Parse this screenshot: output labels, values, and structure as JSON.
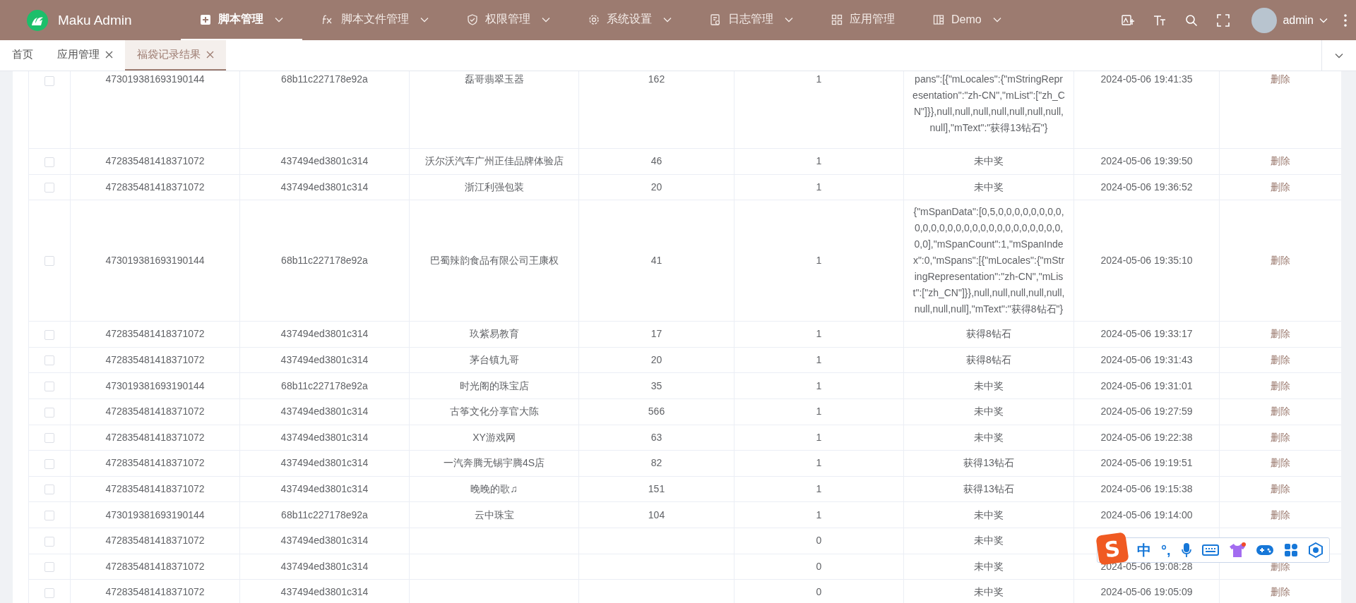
{
  "header": {
    "app_name": "Maku Admin",
    "menu": [
      {
        "label": "脚本管理",
        "kind": "plus",
        "has_submenu": true,
        "selected": true
      },
      {
        "label": "脚本文件管理",
        "kind": "fx",
        "has_submenu": true,
        "selected": false
      },
      {
        "label": "权限管理",
        "kind": "shield",
        "has_submenu": true,
        "selected": false
      },
      {
        "label": "系统设置",
        "kind": "gear",
        "has_submenu": true,
        "selected": false
      },
      {
        "label": "日志管理",
        "kind": "document",
        "has_submenu": true,
        "selected": false
      },
      {
        "label": "应用管理",
        "kind": "grid",
        "has_submenu": false,
        "selected": false
      },
      {
        "label": "Demo",
        "kind": "columns",
        "has_submenu": true,
        "selected": false
      }
    ],
    "user": {
      "name": "admin"
    }
  },
  "tabs": [
    {
      "label": "首页",
      "closable": false,
      "selected": false
    },
    {
      "label": "应用管理",
      "closable": true,
      "selected": false
    },
    {
      "label": "福袋记录结果",
      "closable": true,
      "selected": true
    }
  ],
  "table": {
    "rows": [
      {
        "checked": false,
        "column_2": "473019381693190144",
        "column_3": "68b11c227178e92a",
        "column_4": "磊哥翡翠玉器",
        "column_5": "162",
        "column_6": "1",
        "column_7": "pans\":[{\"mLocales\":{\"mStringRepresentation\":\"zh-CN\",\"mList\":[\"zh_CN\"]}},null,null,null,null,null,null,null,null],\"mText\":\"获得13钻石\"}",
        "column_8": "2024-05-06 19:41:35",
        "column_9": "删除"
      },
      {
        "checked": false,
        "column_2": "472835481418371072",
        "column_3": "437494ed3801c314",
        "column_4": "沃尔沃汽车广州正佳品牌体验店",
        "column_5": "46",
        "column_6": "1",
        "column_7": "未中奖",
        "column_8": "2024-05-06 19:39:50",
        "column_9": "删除"
      },
      {
        "checked": false,
        "column_2": "472835481418371072",
        "column_3": "437494ed3801c314",
        "column_4": "浙江利强包装",
        "column_5": "20",
        "column_6": "1",
        "column_7": "未中奖",
        "column_8": "2024-05-06 19:36:52",
        "column_9": "删除"
      },
      {
        "checked": false,
        "column_2": "473019381693190144",
        "column_3": "68b11c227178e92a",
        "column_4": "巴蜀辣韵食品有限公司王康权",
        "column_5": "41",
        "column_6": "1",
        "column_7": "{\"mSpanData\":[0,5,0,0,0,0,0,0,0,0,0,0,0,0,0,0,0,0,0,0,0,0,0,0,0,0,0,0,0,0],\"mSpanCount\":1,\"mSpanIndex\":0,\"mSpans\":[{\"mLocales\":{\"mStringRepresentation\":\"zh-CN\",\"mList\":[\"zh_CN\"]}},null,null,null,null,null,null,null,null],\"mText\":\"获得8钻石\"}",
        "column_8": "2024-05-06 19:35:10",
        "column_9": "删除"
      },
      {
        "checked": false,
        "column_2": "472835481418371072",
        "column_3": "437494ed3801c314",
        "column_4": "玖紫易教育",
        "column_5": "17",
        "column_6": "1",
        "column_7": "获得8钻石",
        "column_8": "2024-05-06 19:33:17",
        "column_9": "删除"
      },
      {
        "checked": false,
        "column_2": "472835481418371072",
        "column_3": "437494ed3801c314",
        "column_4": "茅台镇九哥",
        "column_5": "20",
        "column_6": "1",
        "column_7": "获得8钻石",
        "column_8": "2024-05-06 19:31:43",
        "column_9": "删除"
      },
      {
        "checked": false,
        "column_2": "473019381693190144",
        "column_3": "68b11c227178e92a",
        "column_4": "时光阁的珠宝店",
        "column_5": "35",
        "column_6": "1",
        "column_7": "未中奖",
        "column_8": "2024-05-06 19:31:01",
        "column_9": "删除"
      },
      {
        "checked": false,
        "column_2": "472835481418371072",
        "column_3": "437494ed3801c314",
        "column_4": "古筝文化分享官大陈",
        "column_5": "566",
        "column_6": "1",
        "column_7": "未中奖",
        "column_8": "2024-05-06 19:27:59",
        "column_9": "删除"
      },
      {
        "checked": false,
        "column_2": "472835481418371072",
        "column_3": "437494ed3801c314",
        "column_4": "XY游戏网",
        "column_5": "63",
        "column_6": "1",
        "column_7": "未中奖",
        "column_8": "2024-05-06 19:22:38",
        "column_9": "删除"
      },
      {
        "checked": false,
        "column_2": "472835481418371072",
        "column_3": "437494ed3801c314",
        "column_4": "一汽奔腾无锡宇腾4S店",
        "column_5": "82",
        "column_6": "1",
        "column_7": "获得13钻石",
        "column_8": "2024-05-06 19:19:51",
        "column_9": "删除"
      },
      {
        "checked": false,
        "column_2": "472835481418371072",
        "column_3": "437494ed3801c314",
        "column_4": "晚晚的歌♫",
        "column_5": "151",
        "column_6": "1",
        "column_7": "获得13钻石",
        "column_8": "2024-05-06 19:15:38",
        "column_9": "删除"
      },
      {
        "checked": false,
        "column_2": "473019381693190144",
        "column_3": "68b11c227178e92a",
        "column_4": "云中珠宝",
        "column_5": "104",
        "column_6": "1",
        "column_7": "未中奖",
        "column_8": "2024-05-06 19:14:00",
        "column_9": "删除"
      },
      {
        "checked": false,
        "column_2": "472835481418371072",
        "column_3": "437494ed3801c314",
        "column_6": "0",
        "column_7": "未中奖"
      },
      {
        "checked": false,
        "column_2": "472835481418371072",
        "column_3": "437494ed3801c314",
        "column_6": "0",
        "column_7": "未中奖",
        "column_8": "2024-05-06 19:08:28",
        "column_9": "删除"
      },
      {
        "checked": false,
        "column_2": "472835481418371072",
        "column_3": "437494ed3801c314",
        "column_6": "0",
        "column_7": "未中奖",
        "column_8": "2024-05-06 19:05:09",
        "column_9": "删除"
      }
    ]
  },
  "input_method_bar": {
    "logo": "S",
    "mode": "中",
    "punctuation": "°,"
  }
}
